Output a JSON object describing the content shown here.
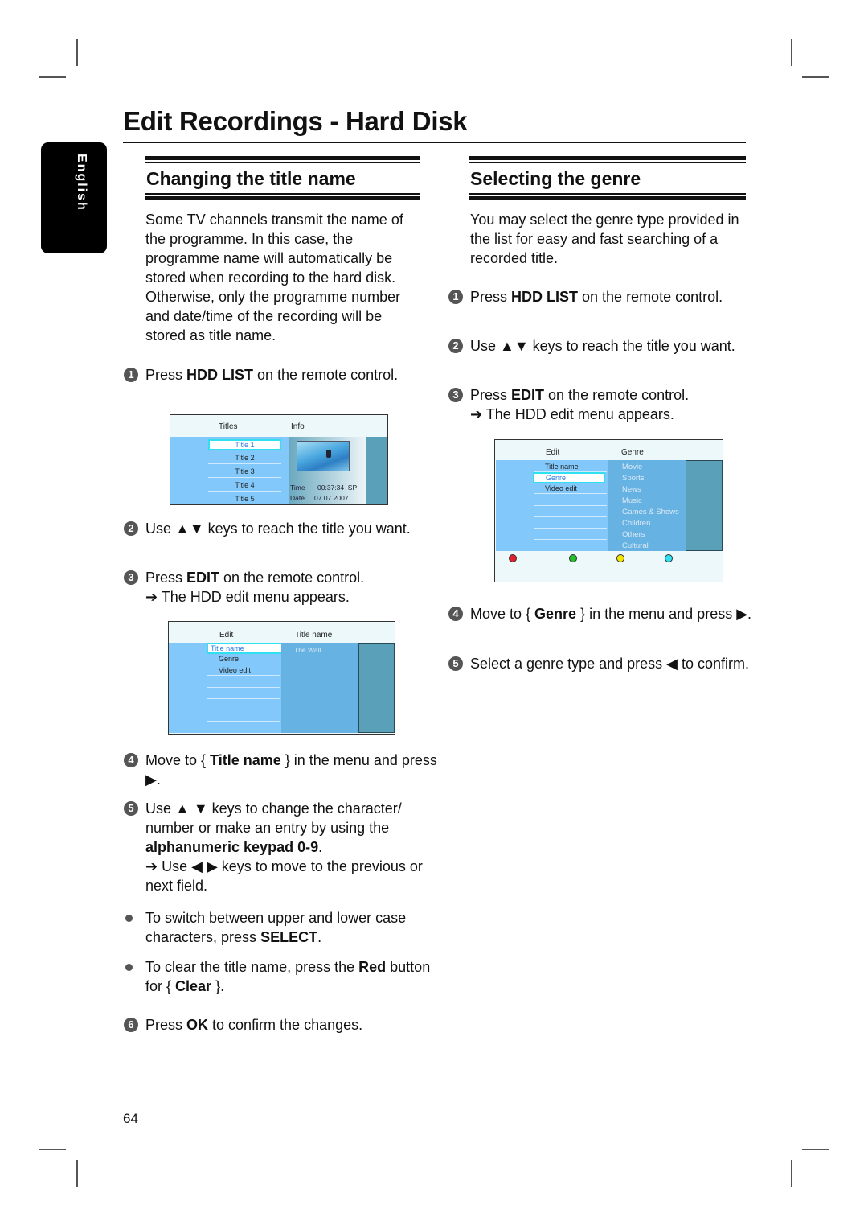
{
  "page": {
    "title": "Edit Recordings - Hard Disk",
    "language_tab": "English",
    "page_number": "64"
  },
  "left_section": {
    "heading": "Changing the title name",
    "intro": "Some TV channels transmit the name of the programme. In this case, the programme name will automatically be stored when recording to the hard disk. Otherwise, only the programme number and date/time of the recording will be stored as title name.",
    "step1": {
      "num": "1",
      "a": "Press ",
      "b": "HDD LIST",
      "c": " on the remote control."
    },
    "step2": {
      "num": "2",
      "text": "Use ▲▼ keys to reach the title you want."
    },
    "step3": {
      "num": "3",
      "a": "Press ",
      "b": "EDIT",
      "c": " on the remote control.",
      "result": "➔ The HDD edit menu appears."
    },
    "step4": {
      "num": "4",
      "a": "Move to { ",
      "b": "Title name",
      "c": " } in the menu and press ▶."
    },
    "step5": {
      "num": "5",
      "a": "Use ▲ ▼ keys to change the character/ number or make an entry by using the ",
      "b": "alphanumeric keypad 0-9",
      "c": ".",
      "result": "➔ Use ◀ ▶ keys to move to the previous or next field."
    },
    "bullet1": {
      "a": "To switch between upper and lower case characters, press ",
      "b": "SELECT",
      "c": "."
    },
    "bullet2": {
      "a": "To clear the title name, press the ",
      "b": "Red",
      "c": " button for { ",
      "d": "Clear",
      "e": " }."
    },
    "step6": {
      "num": "6",
      "a": "Press ",
      "b": "OK",
      "c": " to confirm the changes."
    }
  },
  "screen_titles": {
    "col1": "Titles",
    "col2": "Info",
    "items": [
      "Title 1",
      "Title 2",
      "Title 3",
      "Title 4",
      "Title 5"
    ],
    "selected": "Title 1",
    "time_label": "Time",
    "time_value": "00:37:34  SP",
    "date_label": "Date",
    "date_value": "07.07.2007"
  },
  "screen_edit_title": {
    "col1": "Edit",
    "col2": "Title name",
    "items": [
      "Title name",
      "Genre",
      "Video edit"
    ],
    "selected": "Title name",
    "value": "The Wall"
  },
  "right_section": {
    "heading": "Selecting the genre",
    "intro": "You may select the genre type provided in the list for easy and fast searching of a recorded title.",
    "step1": {
      "num": "1",
      "a": "Press ",
      "b": "HDD LIST",
      "c": " on the remote control."
    },
    "step2": {
      "num": "2",
      "text": "Use ▲▼ keys to reach the title you want."
    },
    "step3": {
      "num": "3",
      "a": "Press ",
      "b": "EDIT",
      "c": " on the remote control.",
      "result": "➔ The HDD edit menu appears."
    },
    "step4": {
      "num": "4",
      "a": "Move to { ",
      "b": "Genre",
      "c": " } in the menu and press ▶."
    },
    "step5": {
      "num": "5",
      "text": "Select a genre type and press ◀ to confirm."
    }
  },
  "screen_genre": {
    "col1": "Edit",
    "col2": "Genre",
    "items": [
      "Title name",
      "Genre",
      "Video edit"
    ],
    "selected": "Genre",
    "genres": [
      "Movie",
      "Sports",
      "News",
      "Music",
      "Games & Shows",
      "Children",
      "Others",
      "Cultural"
    ],
    "color_buttons": {
      "red": "#e0202a",
      "green": "#22c02a",
      "yellow": "#f2e600",
      "cyan": "#30e0f0"
    }
  }
}
